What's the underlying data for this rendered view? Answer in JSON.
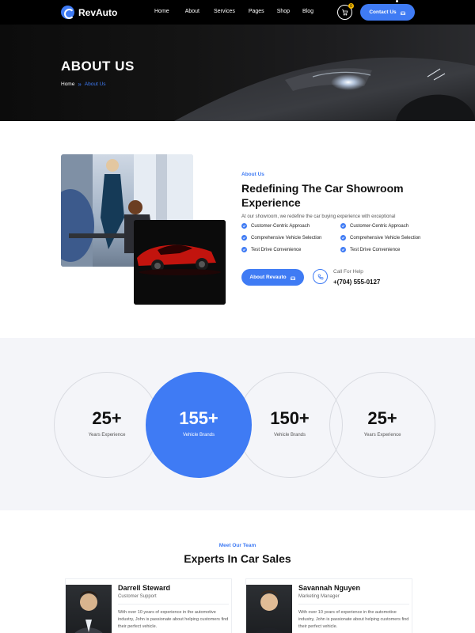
{
  "brand": {
    "name": "RevAuto",
    "accent": "#3f7bf4"
  },
  "nav": {
    "items": [
      "Home",
      "About",
      "Services",
      "Pages",
      "Shop",
      "Blog"
    ]
  },
  "cart": {
    "count": "0"
  },
  "header": {
    "contact_label": "Contact Us"
  },
  "hero": {
    "title": "ABOUT US",
    "breadcrumb_home": "Home",
    "breadcrumb_current": "About Us"
  },
  "about": {
    "eyebrow": "About Us",
    "heading": "Redefining The Car Showroom Experience",
    "description": "At our showroom, we redefine the car buying experience with exceptional",
    "features_left": [
      "Customer-Centric Approach",
      "Comprehensive Vehicle Selection",
      "Test Drive Convenience"
    ],
    "features_right": [
      "Customer-Centric Approach",
      "Comprehensive Vehicle Selection",
      "Test Drive Convenience"
    ],
    "button_label": "About Revauto",
    "help_label": "Call For Help",
    "help_phone": "+(704) 555-0127"
  },
  "stats": [
    {
      "number": "25+",
      "label": "Years Experience"
    },
    {
      "number": "155+",
      "label": "Vehicle Brands"
    },
    {
      "number": "150+",
      "label": "Vehicle Brands"
    },
    {
      "number": "25+",
      "label": "Years Experience"
    }
  ],
  "team": {
    "eyebrow": "Meet Our Team",
    "title": "Experts In Car Sales",
    "members": [
      {
        "name": "Darrell Steward",
        "role": "Customer Support",
        "bio": "With over 10 years of experience in the automotive industry, John is passionate about helping customers find their perfect vehicle."
      },
      {
        "name": "Savannah Nguyen",
        "role": "Marketing Manager",
        "bio": "With over 10 years of experience in the automotive industry, John is passionate about helping customers find their perfect vehicle."
      }
    ]
  }
}
